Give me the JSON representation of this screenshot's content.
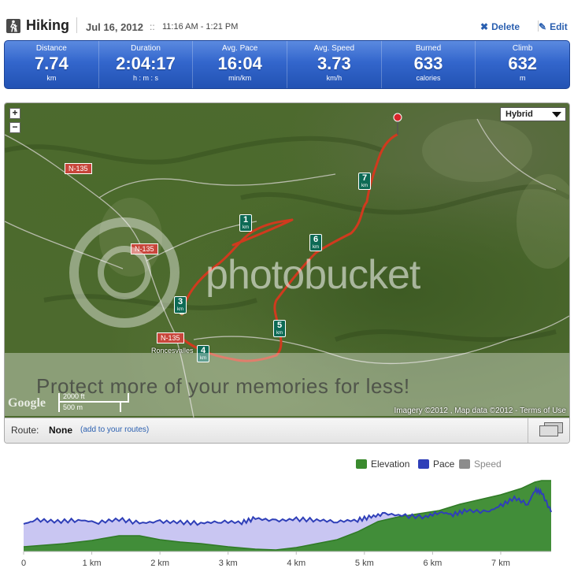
{
  "header": {
    "activity": "Hiking",
    "date": "Jul 16, 2012",
    "separator": "::",
    "time_range": "11:16 AM - 1:21 PM",
    "delete_label": "Delete",
    "edit_label": "Edit"
  },
  "stats": [
    {
      "label": "Distance",
      "value": "7.74",
      "unit": "km"
    },
    {
      "label": "Duration",
      "value": "2:04:17",
      "unit": "h : m : s"
    },
    {
      "label": "Avg. Pace",
      "value": "16:04",
      "unit": "min/km"
    },
    {
      "label": "Avg. Speed",
      "value": "3.73",
      "unit": "km/h"
    },
    {
      "label": "Burned",
      "value": "633",
      "unit": "calories"
    },
    {
      "label": "Climb",
      "value": "632",
      "unit": "m"
    }
  ],
  "map": {
    "zoom_in": "+",
    "zoom_out": "−",
    "map_type": "Hybrid",
    "road_labels": [
      "N-135",
      "N-135",
      "N-135"
    ],
    "town": "Roncesvalles",
    "scale_ft": "2000 ft",
    "scale_m": "500 m",
    "logo": "Google",
    "attribution": "Imagery ©2012 , Map data ©2012 - Terms of Use",
    "markers": [
      {
        "n": "1",
        "u": "km"
      },
      {
        "n": "3",
        "u": "km"
      },
      {
        "n": "4",
        "u": "km"
      },
      {
        "n": "5",
        "u": "km"
      },
      {
        "n": "6",
        "u": "km"
      },
      {
        "n": "7",
        "u": "km"
      }
    ],
    "watermark_brand": "photobucket",
    "watermark_promo": "Protect more of your memories for less!"
  },
  "route": {
    "label": "Route:",
    "value": "None",
    "link": "(add to your routes)"
  },
  "chart_data": {
    "type": "area",
    "legend_position": "top-right",
    "series": [
      {
        "name": "Elevation",
        "color": "#3a8a2e"
      },
      {
        "name": "Pace",
        "color": "#2f3fb8"
      },
      {
        "name": "Speed",
        "color": "#8c8c8c"
      }
    ],
    "xlim": [
      0,
      7.74
    ],
    "x_ticks": [
      "0",
      "1 km",
      "2 km",
      "3 km",
      "4 km",
      "5 km",
      "6 km",
      "7 km"
    ],
    "elevation_relative": {
      "x": [
        0,
        0.3,
        0.6,
        1.0,
        1.4,
        1.7,
        2.0,
        2.3,
        2.6,
        3.0,
        3.4,
        3.7,
        4.0,
        4.3,
        4.6,
        4.9,
        5.2,
        5.5,
        5.8,
        6.1,
        6.4,
        6.7,
        7.0,
        7.3,
        7.5,
        7.6,
        7.74
      ],
      "y": [
        0.06,
        0.08,
        0.1,
        0.14,
        0.2,
        0.2,
        0.15,
        0.12,
        0.1,
        0.06,
        0.03,
        0.02,
        0.05,
        0.1,
        0.15,
        0.25,
        0.38,
        0.44,
        0.48,
        0.52,
        0.6,
        0.66,
        0.72,
        0.8,
        0.88,
        0.9,
        0.9
      ]
    },
    "pace_relative": {
      "x": [
        0,
        0.2,
        0.5,
        0.8,
        1.1,
        1.4,
        1.7,
        2.0,
        2.3,
        2.6,
        2.9,
        3.2,
        3.4,
        3.7,
        4.0,
        4.3,
        4.6,
        4.9,
        5.1,
        5.3,
        5.6,
        5.9,
        6.1,
        6.3,
        6.5,
        6.8,
        7.0,
        7.2,
        7.4,
        7.5,
        7.6,
        7.74
      ],
      "y": [
        0.35,
        0.4,
        0.38,
        0.4,
        0.37,
        0.41,
        0.36,
        0.38,
        0.37,
        0.36,
        0.38,
        0.37,
        0.42,
        0.39,
        0.41,
        0.4,
        0.38,
        0.4,
        0.44,
        0.48,
        0.45,
        0.44,
        0.5,
        0.47,
        0.52,
        0.5,
        0.58,
        0.68,
        0.6,
        0.78,
        0.75,
        0.5
      ]
    }
  }
}
